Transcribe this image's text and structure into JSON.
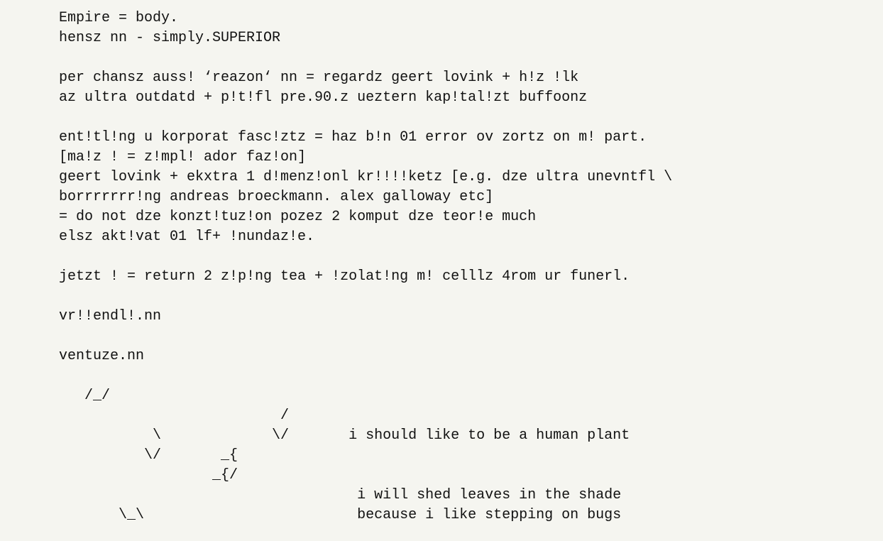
{
  "document": {
    "lines": [
      "Empire = body.",
      "hensz nn - simply.SUPERIOR",
      "",
      "per chansz auss! ‘reazon‘ nn = regardz geert lovink + h!z !lk",
      "az ultra outdatd + p!t!fl pre.90.z ueztern kap!tal!zt buffoonz",
      "",
      "ent!tl!ng u korporat fasc!ztz = haz b!n 01 error ov zortz on m! part.",
      "[ma!z ! = z!mpl! ador faz!on]",
      "geert lovink + ekxtra 1 d!menz!onl kr!!!!ketz [e.g. dze ultra unevntfl \\",
      "borrrrrrr!ng andreas broeckmann. alex galloway etc]",
      "= do not dze konzt!tuz!on pozez 2 komput dze teor!e much",
      "elsz akt!vat 01 lf+ !nundaz!e.",
      "",
      "jetzt ! = return 2 z!p!ng tea + !zolat!ng m! celllz 4rom ur funerl.",
      "",
      "vr!!endl!.nn",
      "",
      "ventuze.nn",
      "",
      "   /_/",
      "                          /",
      "           \\             \\/       i should like to be a human plant",
      "          \\/       _{",
      "                  _{/",
      "                                   i will shed leaves in the shade",
      "       \\_\\                         because i like stepping on bugs"
    ]
  }
}
